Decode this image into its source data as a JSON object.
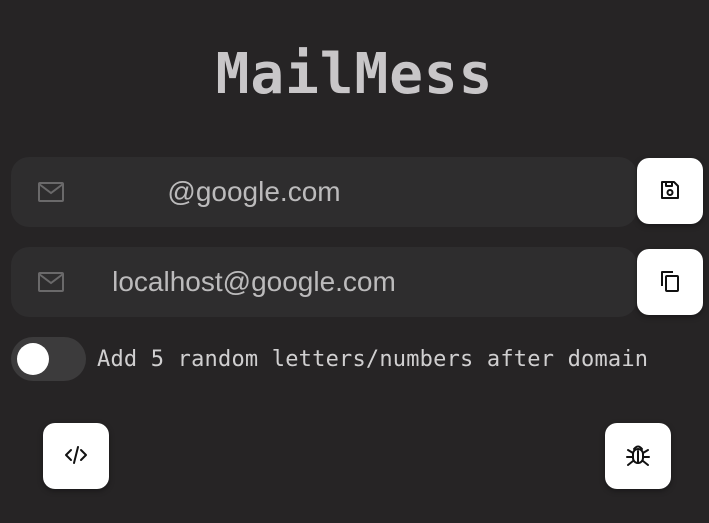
{
  "app": {
    "title": "MailMess"
  },
  "fields": {
    "domain": {
      "value": "@google.com",
      "icon": "mail-icon"
    },
    "generated": {
      "value": "localhost@google.com",
      "icon": "mail-icon"
    }
  },
  "buttons": {
    "save": {
      "icon": "save-icon"
    },
    "copy": {
      "icon": "copy-icon"
    },
    "code": {
      "icon": "code-icon"
    },
    "bug": {
      "icon": "bug-icon"
    }
  },
  "toggle": {
    "label": "Add 5 random letters/numbers after domain",
    "checked": false
  },
  "colors": {
    "background": "#262425",
    "field_background": "#2e2d2e",
    "button_background": "#ffffff",
    "text": "#c9c9c9"
  }
}
